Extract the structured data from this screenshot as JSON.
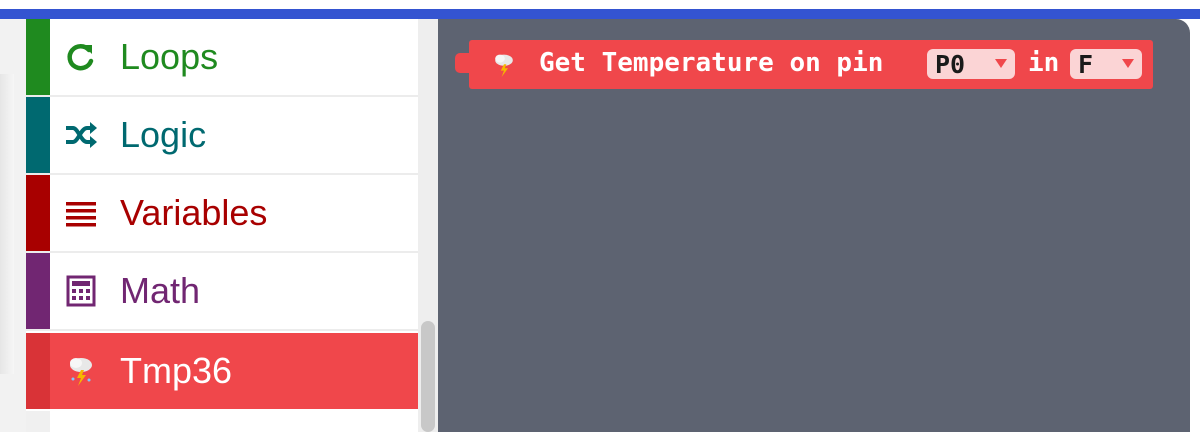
{
  "toolbox": {
    "categories": [
      {
        "label": "Loops",
        "icon": "refresh-icon",
        "color": "#1f8a1f"
      },
      {
        "label": "Logic",
        "icon": "shuffle-icon",
        "color": "#006970"
      },
      {
        "label": "Variables",
        "icon": "list-icon",
        "color": "#a80000"
      },
      {
        "label": "Math",
        "icon": "calculator-icon",
        "color": "#712672"
      },
      {
        "label": "Tmp36",
        "icon": "thermometer-storm-icon",
        "color": "#f0474b",
        "selected": true
      }
    ]
  },
  "workspace": {
    "background": "#5d6371",
    "block": {
      "icon": "thermometer-storm-icon",
      "text_before": "Get Temperature on pin",
      "pin_value": "P0",
      "text_middle": "in",
      "unit_value": "F",
      "color": "#f0474b"
    }
  },
  "colors": {
    "top_accent": "#3454d1"
  }
}
